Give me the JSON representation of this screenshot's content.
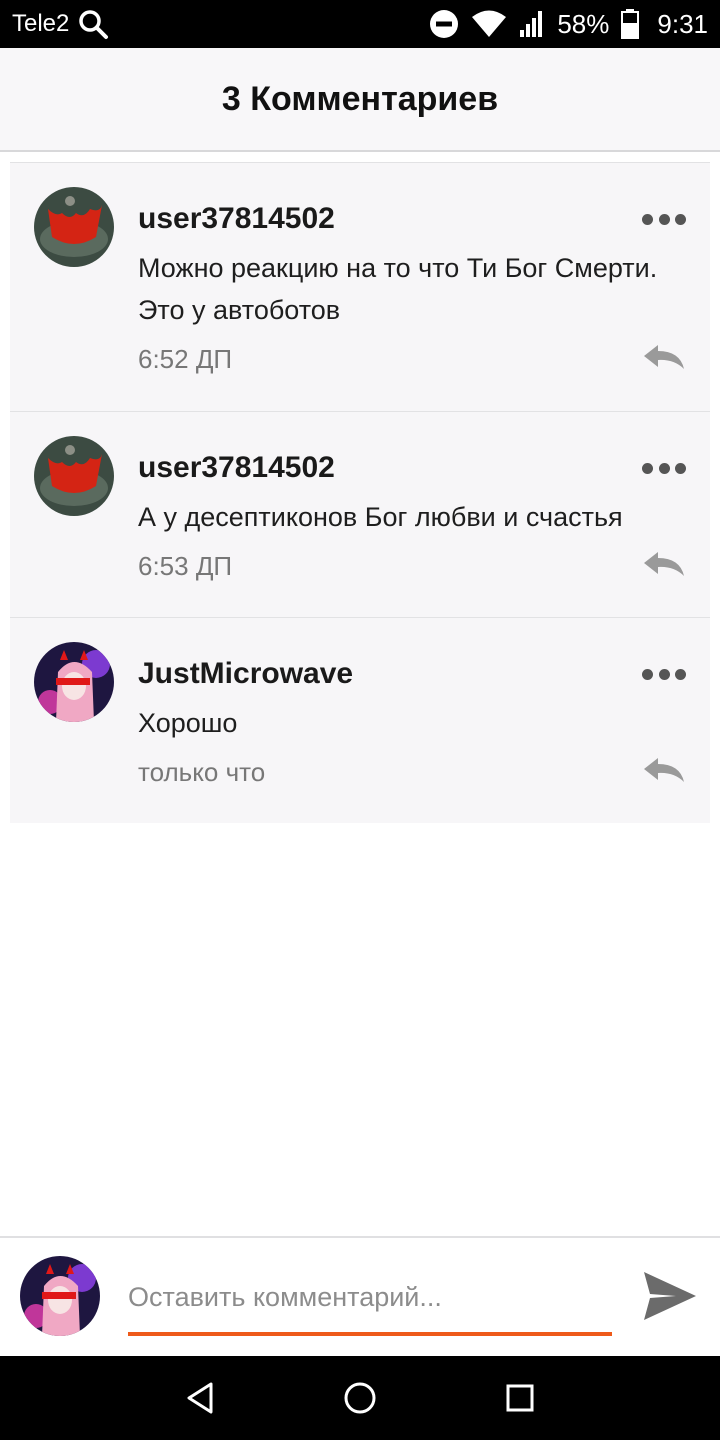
{
  "status_bar": {
    "carrier": "Tele2",
    "battery_percent": "58%",
    "time": "9:31"
  },
  "header": {
    "title": "3 Комментариев"
  },
  "comments": [
    {
      "author": "user37814502",
      "text": "Можно реакцию на то что Ти Бог Смерти. Это у автоботов",
      "time": "6:52 ДП",
      "avatar": "red-cat-avatar"
    },
    {
      "author": "user37814502",
      "text": "А у десептиконов Бог любви и счастья",
      "time": "6:53 ДП",
      "avatar": "red-cat-avatar"
    },
    {
      "author": "JustMicrowave",
      "text": "Хорошо",
      "time": "только что",
      "avatar": "anime-girl-avatar"
    }
  ],
  "composer": {
    "placeholder": "Оставить комментарий...",
    "value": ""
  },
  "colors": {
    "accent": "#ee5a1a",
    "header_bg": "#f8f7f9",
    "comment_bg": "#f7f6f8"
  },
  "icons": {
    "status": [
      "search-icon",
      "do-not-disturb-icon",
      "wifi-icon",
      "signal-icon",
      "battery-icon"
    ],
    "comment": [
      "more-icon",
      "reply-icon"
    ],
    "composer": [
      "send-icon"
    ],
    "nav": [
      "back-icon",
      "home-icon",
      "recents-icon"
    ]
  }
}
